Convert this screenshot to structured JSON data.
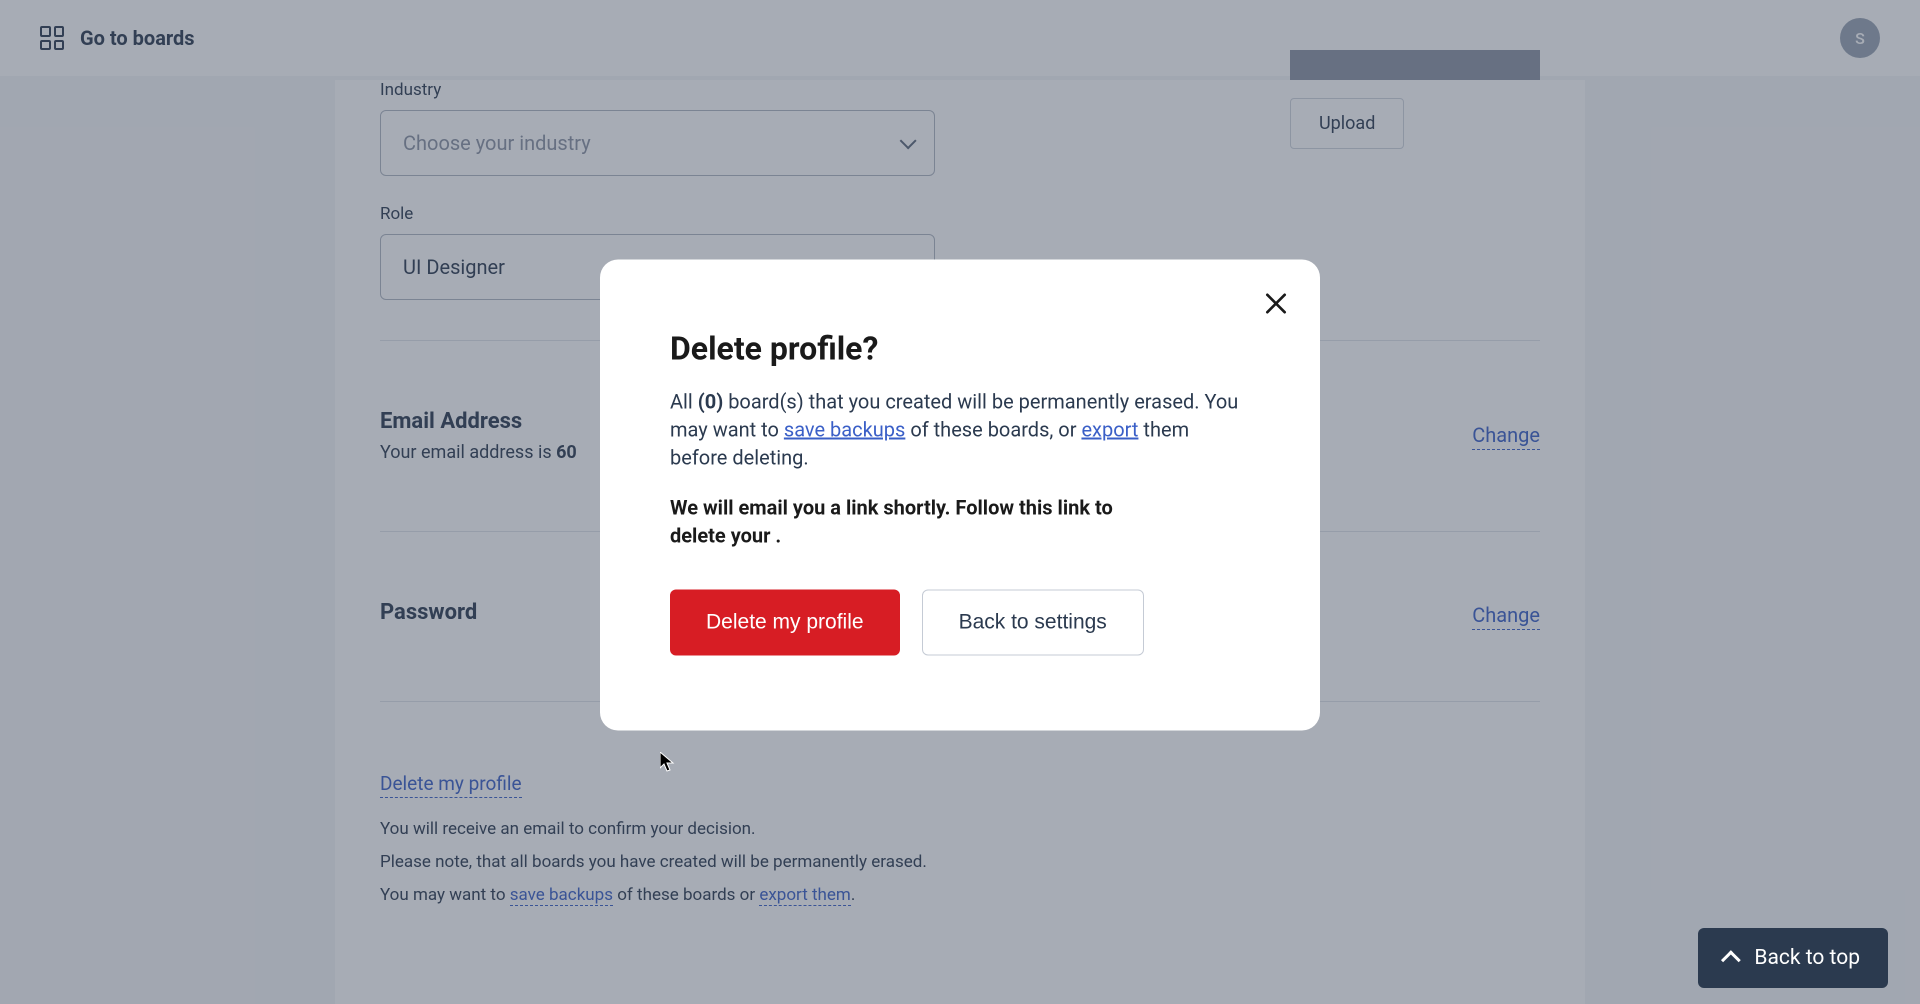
{
  "header": {
    "go_to_boards": "Go to boards",
    "avatar_initial": "S"
  },
  "form": {
    "industry_label": "Industry",
    "industry_placeholder": "Choose your industry",
    "role_label": "Role",
    "role_value": "UI Designer"
  },
  "upload": {
    "button": "Upload"
  },
  "email_section": {
    "title": "Email Address",
    "subtitle_prefix": "Your email address is ",
    "subtitle_value": "60",
    "change": "Change"
  },
  "password_section": {
    "title": "Password",
    "change": "Change"
  },
  "delete_section": {
    "link": "Delete my profile",
    "note1": "You will receive an email to confirm your decision.",
    "note2_prefix": "Please note, that all boards you have created will be permanently erased.",
    "note3_prefix": "You may want to ",
    "save_backups": "save backups",
    "note3_mid": " of these boards or ",
    "export_them": "export them",
    "note3_suffix": "."
  },
  "modal": {
    "title": "Delete profile?",
    "body_prefix": "All ",
    "board_count": "(0)",
    "body_mid1": " board(s) that you created will be permanently erased. You may want to ",
    "save_backups": "save backups",
    "body_mid2": " of these boards, or ",
    "export": "export",
    "body_suffix": " them before deleting.",
    "emphasis": "We will email you a link shortly. Follow this link to delete your .",
    "delete_btn": "Delete my profile",
    "back_btn": "Back to settings"
  },
  "back_to_top": "Back to top"
}
